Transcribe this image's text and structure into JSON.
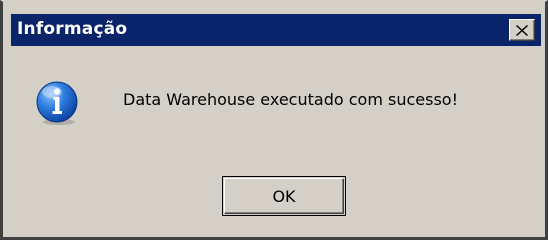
{
  "dialog": {
    "title": "Informação",
    "message": "Data Warehouse executado com sucesso!",
    "ok_label": "OK",
    "icon": "info-icon",
    "colors": {
      "titlebar": "#0a246a",
      "face": "#d4d0c8",
      "icon_blue": "#1560c8"
    }
  }
}
